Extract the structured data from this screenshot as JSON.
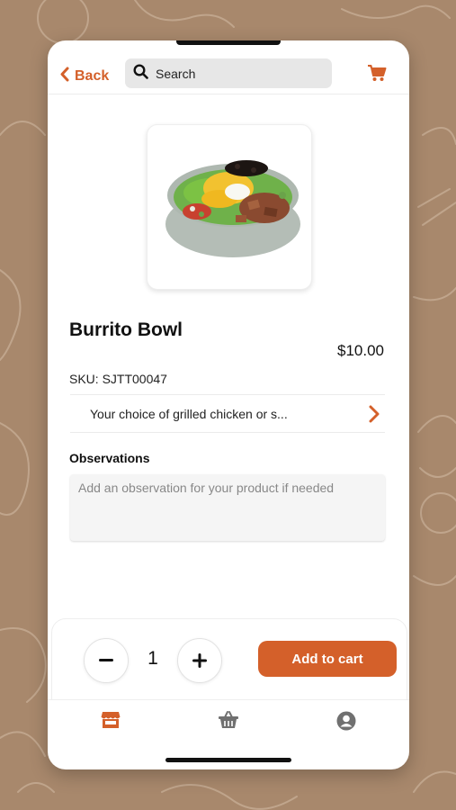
{
  "header": {
    "back_label": "Back",
    "search_placeholder": "Search",
    "icons": {
      "back": "chevron-left-icon",
      "search": "search-icon",
      "cart": "cart-icon"
    }
  },
  "product": {
    "title": "Burrito Bowl",
    "price": "$10.00",
    "sku": "SKU: SJTT00047",
    "description": "Your choice of grilled chicken or s..."
  },
  "observations": {
    "label": "Observations",
    "placeholder": "Add an observation for your product if needed"
  },
  "order": {
    "quantity": "1",
    "add_label": "Add to cart"
  },
  "tabbar": {
    "items": [
      {
        "icon": "store-icon",
        "active": true
      },
      {
        "icon": "basket-icon",
        "active": false
      },
      {
        "icon": "profile-icon",
        "active": false
      }
    ]
  },
  "colors": {
    "accent": "#d4602a",
    "background": "#a8886c",
    "inactive": "#707070"
  }
}
